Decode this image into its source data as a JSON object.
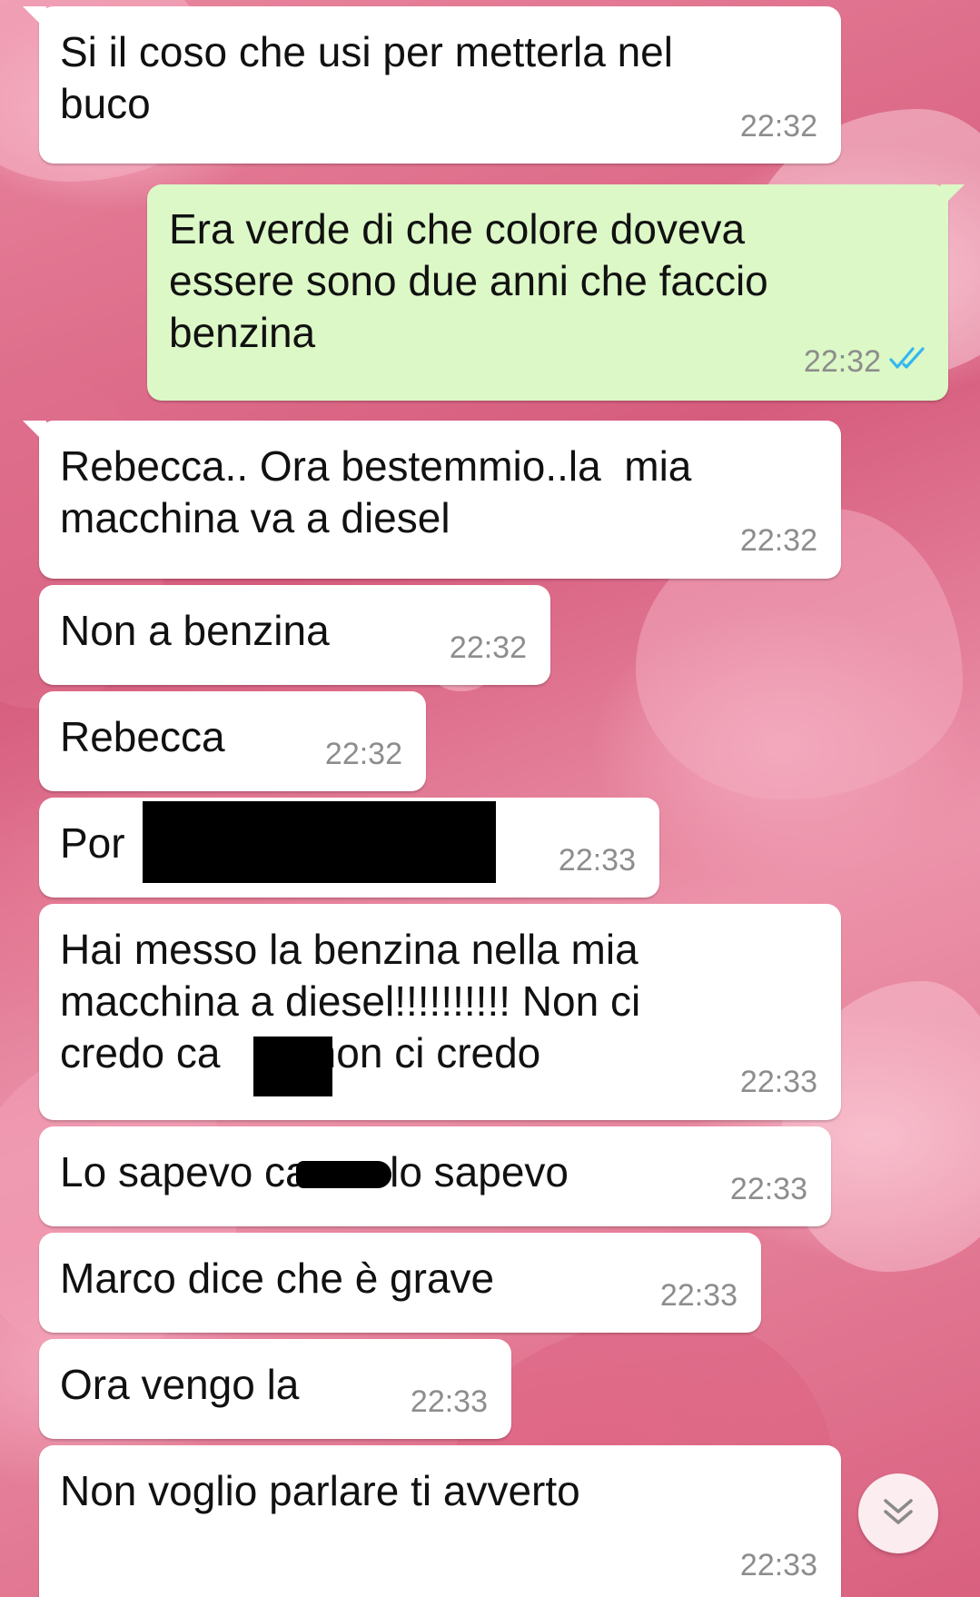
{
  "chat": {
    "messages": [
      {
        "direction": "incoming",
        "text": "Si il coso che usi per metterla nel\nbuco",
        "time": "22:32"
      },
      {
        "direction": "outgoing",
        "text": "Era verde di che colore doveva\nessere sono due anni che faccio\nbenzina",
        "time": "22:32",
        "status": "read",
        "status_icon": "double-check-icon",
        "status_color": "#34b7f1"
      },
      {
        "direction": "incoming",
        "text": "Rebecca.. Ora bestemmio..la  mia\nmacchina va a diesel",
        "time": "22:32"
      },
      {
        "direction": "incoming",
        "text": "Non a benzina",
        "time": "22:32"
      },
      {
        "direction": "incoming",
        "text": "Rebecca",
        "time": "22:32"
      },
      {
        "direction": "incoming",
        "text": "Por",
        "time": "22:33",
        "redacted": true
      },
      {
        "direction": "incoming",
        "text": "Hai messo la benzina nella mia\nmacchina a diesel!!!!!!!!!! Non ci\ncredo ca        non ci credo",
        "time": "22:33",
        "redacted": true
      },
      {
        "direction": "incoming",
        "text": "Lo sapevo ca       lo sapevo",
        "time": "22:33",
        "redacted": true
      },
      {
        "direction": "incoming",
        "text": "Marco dice che è grave",
        "time": "22:33"
      },
      {
        "direction": "incoming",
        "text": "Ora vengo la",
        "time": "22:33"
      },
      {
        "direction": "incoming",
        "text": "Non voglio parlare ti avverto",
        "time": "22:33"
      }
    ]
  },
  "scroll_button": {
    "icon": "double-chevron-down-icon"
  },
  "colors": {
    "incoming_bubble": "#ffffff",
    "outgoing_bubble": "#dcf8c6",
    "timestamp": "#8d8d8d",
    "read_ticks": "#34b7f1",
    "redaction": "#000000"
  }
}
